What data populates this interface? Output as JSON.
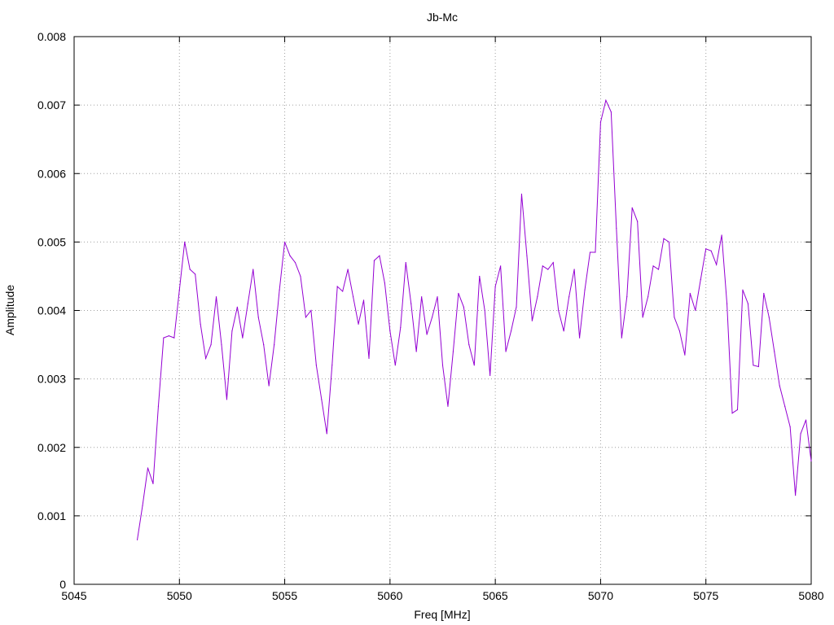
{
  "chart_data": {
    "type": "line",
    "title": "Jb-Mc",
    "xlabel": "Freq [MHz]",
    "ylabel": "Amplitude",
    "xlim": [
      5045,
      5080
    ],
    "ylim": [
      0,
      0.008
    ],
    "x_ticks": [
      "5045",
      "5050",
      "5055",
      "5060",
      "5065",
      "5070",
      "5075",
      "5080"
    ],
    "y_ticks": [
      "0",
      "0.001",
      "0.002",
      "0.003",
      "0.004",
      "0.005",
      "0.006",
      "0.007",
      "0.008"
    ],
    "grid": true,
    "grid_style": "dotted",
    "line_color": "#9400d3",
    "series": [
      {
        "x": [
          5048.0,
          5048.25,
          5048.5,
          5048.75,
          5049.0,
          5049.25,
          5049.5,
          5049.75,
          5050.0,
          5050.25,
          5050.5,
          5050.75,
          5051.0,
          5051.25,
          5051.5,
          5051.75,
          5052.0,
          5052.25,
          5052.5,
          5052.75,
          5053.0,
          5053.25,
          5053.5,
          5053.75,
          5054.0,
          5054.25,
          5054.5,
          5054.75,
          5055.0,
          5055.25,
          5055.5,
          5055.75,
          5056.0,
          5056.25,
          5056.5,
          5056.75,
          5057.0,
          5057.25,
          5057.5,
          5057.75,
          5058.0,
          5058.25,
          5058.5,
          5058.75,
          5059.0,
          5059.25,
          5059.5,
          5059.75,
          5060.0,
          5060.25,
          5060.5,
          5060.75,
          5061.0,
          5061.25,
          5061.5,
          5061.75,
          5062.0,
          5062.25,
          5062.5,
          5062.75,
          5063.0,
          5063.25,
          5063.5,
          5063.75,
          5064.0,
          5064.25,
          5064.5,
          5064.75,
          5065.0,
          5065.25,
          5065.5,
          5065.75,
          5066.0,
          5066.25,
          5066.5,
          5066.75,
          5067.0,
          5067.25,
          5067.5,
          5067.75,
          5068.0,
          5068.25,
          5068.5,
          5068.75,
          5069.0,
          5069.25,
          5069.5,
          5069.75,
          5070.0,
          5070.25,
          5070.5,
          5070.75,
          5071.0,
          5071.25,
          5071.5,
          5071.75,
          5072.0,
          5072.25,
          5072.5,
          5072.75,
          5073.0,
          5073.25,
          5073.5,
          5073.75,
          5074.0,
          5074.25,
          5074.5,
          5074.75,
          5075.0,
          5075.25,
          5075.5,
          5075.75,
          5076.0,
          5076.25,
          5076.5,
          5076.75,
          5077.0,
          5077.25,
          5077.5,
          5077.75,
          5078.0,
          5078.25,
          5078.5,
          5078.75,
          5079.0,
          5079.25,
          5079.5,
          5079.75,
          5080.0
        ],
        "y": [
          0.00065,
          0.00115,
          0.0017,
          0.00147,
          0.0026,
          0.0036,
          0.00363,
          0.0036,
          0.0043,
          0.005,
          0.0046,
          0.00453,
          0.0038,
          0.0033,
          0.0035,
          0.0042,
          0.0035,
          0.0027,
          0.0037,
          0.00405,
          0.0036,
          0.0041,
          0.0046,
          0.0039,
          0.0035,
          0.0029,
          0.0035,
          0.0043,
          0.005,
          0.0048,
          0.0047,
          0.0045,
          0.0039,
          0.004,
          0.0032,
          0.0027,
          0.0022,
          0.0032,
          0.00435,
          0.00428,
          0.0046,
          0.0042,
          0.0038,
          0.00415,
          0.0033,
          0.00473,
          0.0048,
          0.0044,
          0.0037,
          0.0032,
          0.00375,
          0.0047,
          0.0041,
          0.0034,
          0.0042,
          0.00365,
          0.0039,
          0.0042,
          0.0032,
          0.0026,
          0.0034,
          0.00425,
          0.00405,
          0.0035,
          0.0032,
          0.0045,
          0.004,
          0.00305,
          0.00435,
          0.00465,
          0.0034,
          0.0037,
          0.00405,
          0.0057,
          0.0048,
          0.00385,
          0.0042,
          0.00465,
          0.0046,
          0.0047,
          0.004,
          0.0037,
          0.0042,
          0.0046,
          0.0036,
          0.0043,
          0.00485,
          0.00485,
          0.00675,
          0.00707,
          0.0069,
          0.0052,
          0.0036,
          0.0042,
          0.0055,
          0.0053,
          0.0039,
          0.0042,
          0.00465,
          0.0046,
          0.00505,
          0.005,
          0.0039,
          0.0037,
          0.00335,
          0.00425,
          0.004,
          0.00445,
          0.0049,
          0.00487,
          0.00467,
          0.0051,
          0.0041,
          0.0025,
          0.00255,
          0.0043,
          0.0041,
          0.0032,
          0.00318,
          0.00425,
          0.0039,
          0.0034,
          0.0029,
          0.0026,
          0.0023,
          0.0013,
          0.0022,
          0.0024,
          0.0018
        ]
      }
    ]
  }
}
